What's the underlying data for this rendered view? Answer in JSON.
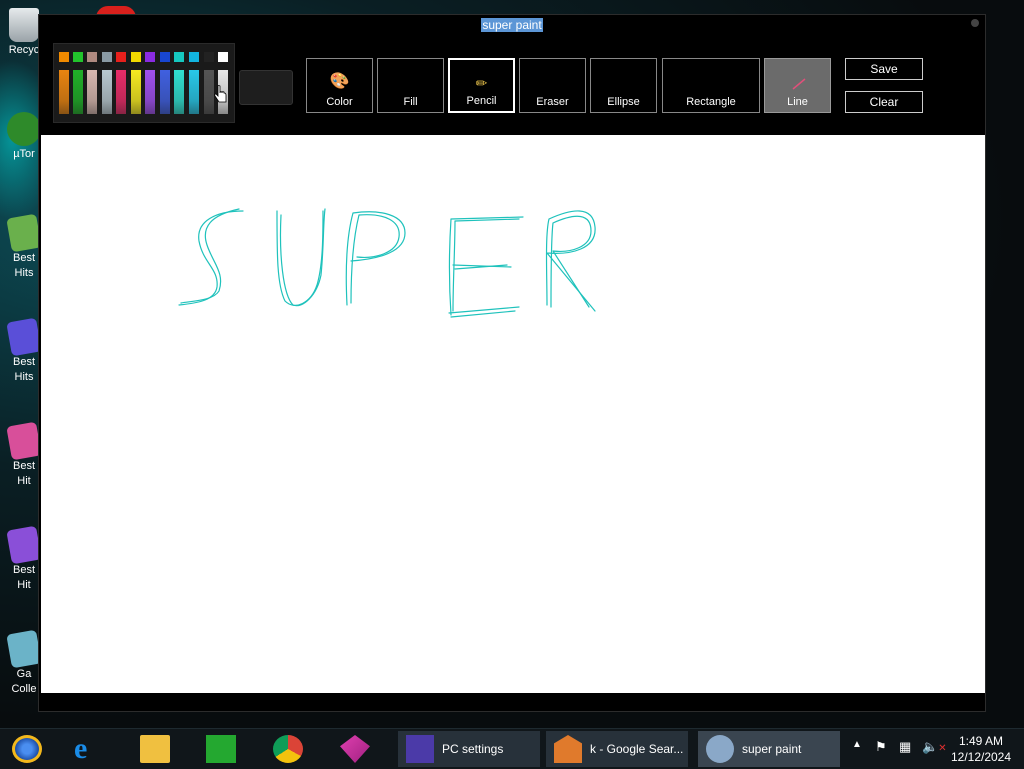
{
  "desktop": {
    "icons": [
      {
        "label": "Recyc",
        "color": "#cfd5d8"
      },
      {
        "label": "µTor",
        "color": "#4aa33a"
      },
      {
        "label": "Best",
        "label2": "Hits",
        "color": "#6ab04c"
      },
      {
        "label": "Best",
        "label2": "Hits",
        "color": "#5a4fd8"
      },
      {
        "label": "Best",
        "label2": "Hit",
        "color": "#d84f9a"
      },
      {
        "label": "Best",
        "label2": "Hit",
        "color": "#8a4fd8"
      },
      {
        "label": "Ga",
        "label2": "Colle",
        "color": "#6bb3c8"
      }
    ]
  },
  "window": {
    "title": "super paint"
  },
  "palette": {
    "colors": [
      "#f08a00",
      "#22c42c",
      "#b08a80",
      "#8a9aa4",
      "#e8201c",
      "#f2d800",
      "#8a2be2",
      "#1846d0",
      "#16c8c0",
      "#12b4e0",
      "#222222",
      "#ffffff"
    ],
    "bars": [
      "#e88410",
      "#20b028",
      "#d8b8b0",
      "#b8c8d0",
      "#e82c68",
      "#f6ea20",
      "#a050f0",
      "#4060e0",
      "#30e0d0",
      "#28c8e8",
      "#555555",
      "#e8e8e8"
    ]
  },
  "current_color": "#1e1e1e",
  "tools": [
    {
      "id": "color",
      "label": "Color",
      "icon": "palette-icon",
      "glyph": "🎨"
    },
    {
      "id": "fill",
      "label": "Fill",
      "icon": "",
      "glyph": ""
    },
    {
      "id": "pencil",
      "label": "Pencil",
      "icon": "pencil-icon",
      "glyph": "✏"
    },
    {
      "id": "eraser",
      "label": "Eraser",
      "icon": "",
      "glyph": ""
    },
    {
      "id": "ellipse",
      "label": "Ellipse",
      "icon": "",
      "glyph": ""
    },
    {
      "id": "rectangle",
      "label": "Rectangle",
      "icon": "",
      "glyph": ""
    },
    {
      "id": "line",
      "label": "Line",
      "icon": "line-icon",
      "glyph": ""
    }
  ],
  "selected_tool": "pencil",
  "active_tool": "line",
  "actions": {
    "save_label": "Save",
    "clear_label": "Clear"
  },
  "drawing": {
    "text": "SUPER",
    "stroke_color": "#1fc2bc"
  },
  "taskbar": {
    "tasks": [
      {
        "label": "PC settings",
        "icon": "gear-icon"
      },
      {
        "label": "k - Google Sear...",
        "icon": "browser-icon"
      },
      {
        "label": "super paint",
        "icon": "paint-icon"
      }
    ],
    "clock": {
      "time": "1:49 AM",
      "date": "12/12/2024"
    }
  }
}
